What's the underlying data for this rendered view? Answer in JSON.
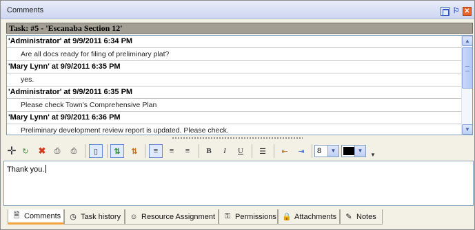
{
  "window": {
    "title": "Comments"
  },
  "task": {
    "header": "Task: #5 - 'Escanaba Section 12'"
  },
  "comments": [
    {
      "author_line": "'Administrator' at 9/9/2011 6:34 PM",
      "text": "Are all docs ready for filing of preliminary plat?"
    },
    {
      "author_line": "'Mary Lynn' at 9/9/2011 6:35 PM",
      "text": "yes."
    },
    {
      "author_line": "'Administrator' at 9/9/2011 6:35 PM",
      "text": "Please check Town's Comprehensive Plan"
    },
    {
      "author_line": "'Mary Lynn' at 9/9/2011 6:36 PM",
      "text": "Preliminary development review report is updated. Please check."
    }
  ],
  "toolbar": {
    "font_size": "8",
    "bold": "B",
    "italic": "I",
    "underline": "U",
    "color": "#000000"
  },
  "editor": {
    "value": "Thank you."
  },
  "tabs": [
    {
      "label": "Comments",
      "icon": "comments-icon"
    },
    {
      "label": "Task history",
      "icon": "clock-icon"
    },
    {
      "label": "Resource Assignment",
      "icon": "person-icon"
    },
    {
      "label": "Permissions",
      "icon": "key-icon"
    },
    {
      "label": "Attachments",
      "icon": "lock-icon"
    },
    {
      "label": "Notes",
      "icon": "notes-icon"
    }
  ]
}
